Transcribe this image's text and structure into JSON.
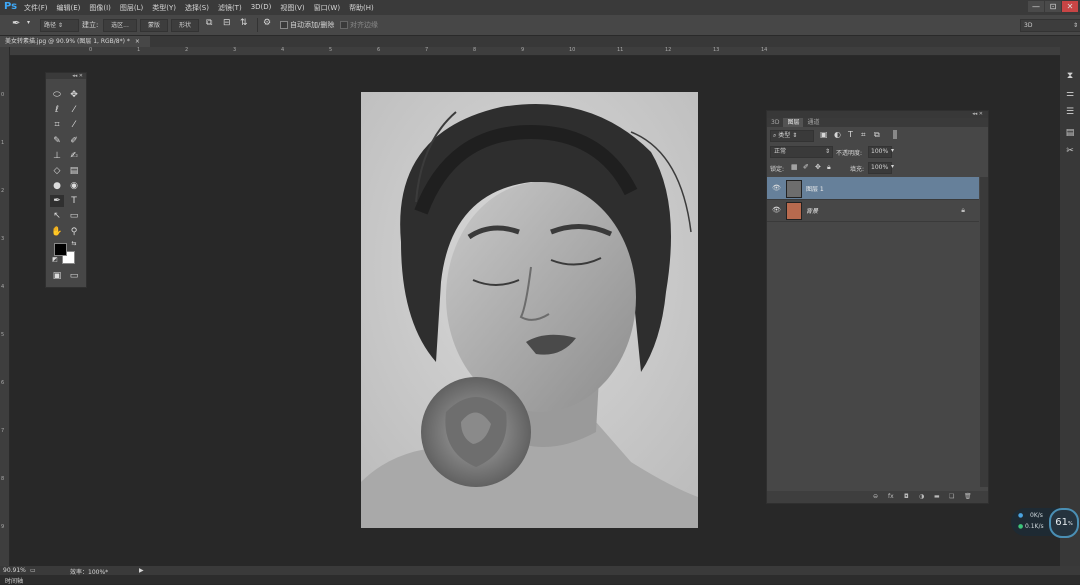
{
  "app": {
    "logo": "Ps"
  },
  "menu": [
    "文件(F)",
    "编辑(E)",
    "图像(I)",
    "图层(L)",
    "类型(Y)",
    "选择(S)",
    "滤镜(T)",
    "3D(D)",
    "视图(V)",
    "窗口(W)",
    "帮助(H)"
  ],
  "window_controls": {
    "minimize": "—",
    "restore": "⊡",
    "close": "✕"
  },
  "options_bar": {
    "mode": "路径",
    "create_label": "建立:",
    "selection_btn": "选区...",
    "mask_btn": "蒙版",
    "shape_btn": "形状",
    "auto_add_delete": "自动添加/删除",
    "align_edges": "对齐边缘",
    "workspace": "3D"
  },
  "document_tab": {
    "title": "美女转素描.jpg @ 90.9% (图层 1, RGB/8*) *",
    "close": "×"
  },
  "ruler": {
    "h_ticks": [
      "0",
      "1",
      "2",
      "3",
      "4",
      "5",
      "6",
      "7",
      "8",
      "9",
      "10",
      "11",
      "12",
      "13",
      "14"
    ],
    "v_ticks": [
      "0",
      "1",
      "2",
      "3",
      "4",
      "5",
      "6",
      "7",
      "8",
      "9"
    ]
  },
  "toolbox": {
    "header": "◂◂ ✕"
  },
  "layers_panel": {
    "header": "◂◂ ✕",
    "tabs": [
      "3D",
      "图层",
      "通道"
    ],
    "filter_kind": "类型",
    "blend_mode": "正常",
    "opacity_label": "不透明度:",
    "opacity_value": "100%",
    "lock_label": "锁定:",
    "fill_label": "填充:",
    "fill_value": "100%",
    "layers": [
      {
        "name": "图层 1",
        "selected": true,
        "locked": false
      },
      {
        "name": "背景",
        "selected": false,
        "locked": true
      }
    ],
    "footer_icons": [
      "link-icon",
      "fx-icon",
      "mask-icon",
      "adjustment-icon",
      "folder-icon",
      "new-layer-icon",
      "trash-icon"
    ]
  },
  "status_bar": {
    "zoom": "90.91%",
    "efficiency": "效率：100%*",
    "timeline": "时间轴"
  },
  "net_widget": {
    "up": "0K/s",
    "down": "0.1K/s",
    "percent": "61",
    "pct_sign": "%"
  },
  "colors": {
    "selected_layer": "#66809a",
    "menubar": "#3a3a3a",
    "panel": "#474747",
    "canvas_bg": "#282828",
    "accent": "#3ea7f5"
  }
}
